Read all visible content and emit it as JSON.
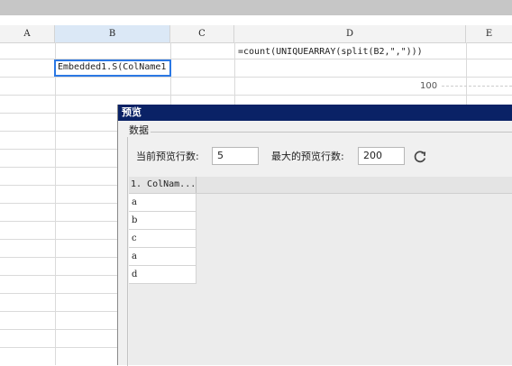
{
  "sheet": {
    "columns": [
      "A",
      "B",
      "C",
      "D",
      "E"
    ],
    "selected_column": "B",
    "cells": {
      "d1_formula": "=count(UNIQUEARRAY(split(B2,\",\")))",
      "b2_value": "Embedded1.S(ColName1",
      "d3_value": "100"
    }
  },
  "dialog": {
    "title": "预览",
    "group_label": "数据",
    "preview_rows_label": "当前预览行数:",
    "preview_rows_value": "5",
    "max_rows_label": "最大的预览行数:",
    "max_rows_value": "200",
    "refresh_icon": "refresh-icon",
    "table": {
      "header": "1. ColNam...",
      "rows": [
        "a",
        "b",
        "c",
        "a",
        "d"
      ]
    }
  },
  "colors": {
    "dialog_title_bg": "#0a2266",
    "selection_border": "#2b78e4",
    "selected_header_bg": "#dbe8f6"
  }
}
